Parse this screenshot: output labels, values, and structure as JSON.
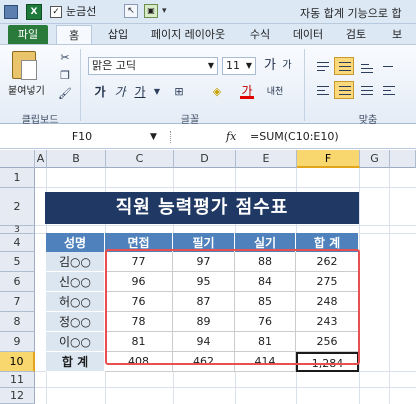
{
  "window": {
    "title": "자동 합계 기능으로 합",
    "qat": {
      "gridlines_label": "눈금선",
      "gridlines_checked": "✓",
      "excel_icon": "X"
    }
  },
  "tabs": [
    {
      "label": "파일"
    },
    {
      "label": "홈"
    },
    {
      "label": "삽입"
    },
    {
      "label": "페이지 레이아웃"
    },
    {
      "label": "수식"
    },
    {
      "label": "데이터"
    },
    {
      "label": "검토"
    },
    {
      "label": "보"
    }
  ],
  "ribbon": {
    "clipboard": {
      "paste_label": "붙여넣기",
      "group_label": "클립보드"
    },
    "font": {
      "font_name": "맑은 고딕",
      "font_size": "11",
      "group_label": "글꼴",
      "bold": "가",
      "italic": "가",
      "underline": "가",
      "grow": "가",
      "shrink": "가",
      "font_color_letter": "가",
      "phonetic": "내천"
    },
    "alignment": {
      "group_label": "맞춤"
    }
  },
  "formula_bar": {
    "name_box": "F10",
    "fx": "fx",
    "formula": "=SUM(C10:E10)"
  },
  "sheet": {
    "columns": [
      "A",
      "B",
      "C",
      "D",
      "E",
      "F",
      "G"
    ],
    "rows": [
      "1",
      "2",
      "3",
      "4",
      "5",
      "6",
      "7",
      "8",
      "9",
      "10",
      "11",
      "12"
    ],
    "selected_column": "F",
    "selected_row": "10",
    "title": "직원 능력평가 점수표",
    "headers": [
      "성명",
      "면접",
      "필기",
      "실기",
      "합 계"
    ],
    "data_rows": [
      {
        "name": "김○○",
        "interview": "77",
        "written": "97",
        "practical": "88",
        "total": "262"
      },
      {
        "name": "신○○",
        "interview": "96",
        "written": "95",
        "practical": "84",
        "total": "275"
      },
      {
        "name": "허○○",
        "interview": "76",
        "written": "87",
        "practical": "85",
        "total": "248"
      },
      {
        "name": "정○○",
        "interview": "78",
        "written": "89",
        "practical": "76",
        "total": "243"
      },
      {
        "name": "이○○",
        "interview": "81",
        "written": "94",
        "practical": "81",
        "total": "256"
      }
    ],
    "total_row": {
      "label": "합 계",
      "interview": "408",
      "written": "462",
      "practical": "414",
      "total": "1,284"
    }
  },
  "colors": {
    "title_band": "#1f3864",
    "header_fill": "#4f81bd",
    "name_fill": "#dce6f1",
    "highlight_box": "#e8504f",
    "file_tab": "#2a7a3b",
    "selection_header": "#f8d76f"
  }
}
